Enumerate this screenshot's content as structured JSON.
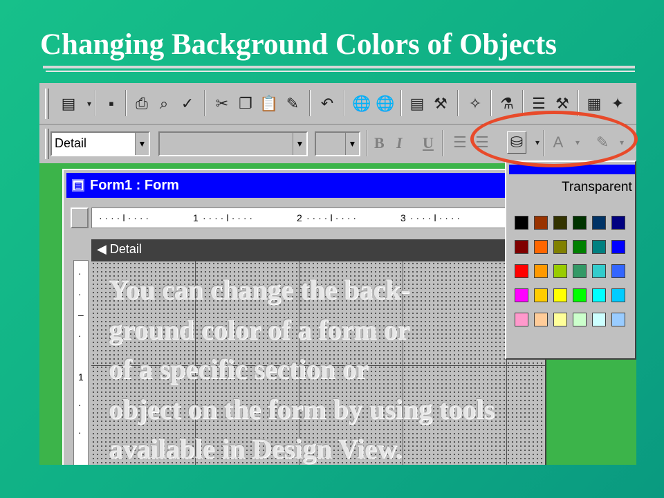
{
  "slide": {
    "title": "Changing Background Colors of Objects",
    "body_lines": [
      "You can change the back-",
      "ground color of a form or",
      "of a specific section or",
      "object on the form by using tools",
      "available in Design View."
    ]
  },
  "toolbar2": {
    "object_combo_value": "Detail",
    "bold_label": "B",
    "italic_label": "I",
    "underline_label": "U"
  },
  "form_window": {
    "title": "Form1 : Form",
    "section_label": "Detail",
    "ruler_marks": [
      "1",
      "2",
      "3"
    ],
    "vertical_ruler_marks": [
      "1"
    ]
  },
  "palette": {
    "transparent_label": "Transparent",
    "rows": [
      [
        "#000000",
        "#993300",
        "#333300",
        "#003300",
        "#003366",
        "#000080"
      ],
      [
        "#800000",
        "#ff6600",
        "#808000",
        "#008000",
        "#008080",
        "#0000ff"
      ],
      [
        "#ff0000",
        "#ff9900",
        "#99cc00",
        "#339966",
        "#33cccc",
        "#3366ff"
      ],
      [
        "#ff00ff",
        "#ffcc00",
        "#ffff00",
        "#00ff00",
        "#00ffff",
        "#00ccff"
      ],
      [
        "#ff99cc",
        "#ffcc99",
        "#ffff99",
        "#ccffcc",
        "#ccffff",
        "#99ccff"
      ]
    ]
  },
  "colors": {
    "slide_background": "#12b488",
    "highlight_circle": "#e84a2a",
    "title_bar": "#0000ff"
  }
}
